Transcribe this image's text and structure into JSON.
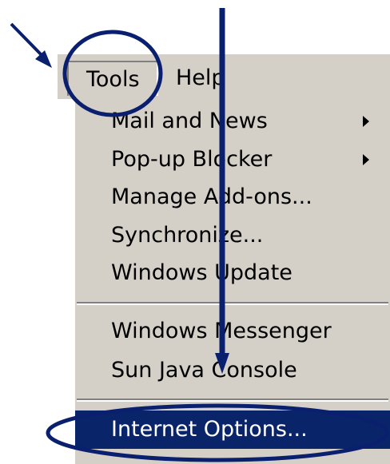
{
  "menubar": {
    "tools_label": "Tools",
    "help_label": "Help"
  },
  "tools_menu": {
    "items": [
      {
        "label": "Mail and News",
        "submenu": true
      },
      {
        "label": "Pop-up Blocker",
        "submenu": true
      },
      {
        "label": "Manage Add-ons...",
        "submenu": false
      },
      {
        "label": "Synchronize...",
        "submenu": false
      },
      {
        "label": "Windows Update",
        "submenu": false
      },
      {
        "label": "Windows Messenger",
        "submenu": false
      },
      {
        "label": "Sun Java Console",
        "submenu": false
      },
      {
        "label": "Internet Options...",
        "submenu": false,
        "selected": true
      }
    ]
  },
  "colors": {
    "menu_bg": "#d4d0c8",
    "selection_bg": "#0a246a",
    "annotation": "#0a1f6e"
  },
  "annotations": {
    "icons": [
      "pointer-arrow-icon",
      "vertical-arrow-icon",
      "tools-highlight-circle",
      "internet-options-highlight-ellipse"
    ]
  }
}
